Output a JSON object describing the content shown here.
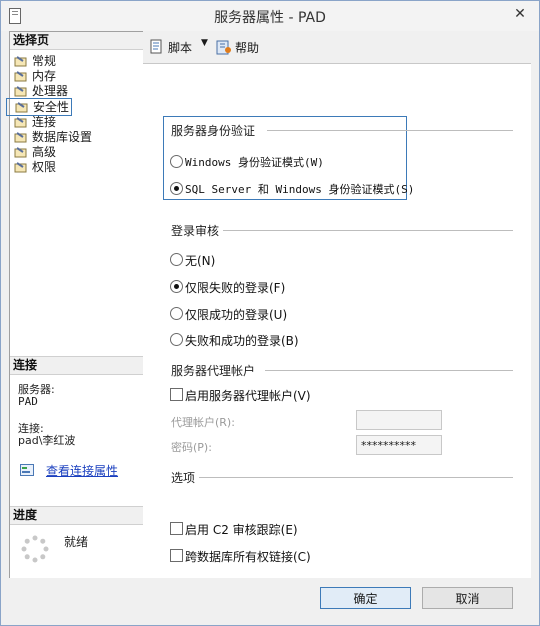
{
  "window": {
    "title": "服务器属性 - PAD",
    "close_glyph": "✕"
  },
  "left_pane": {
    "select_page_header": "选择页",
    "items": [
      {
        "label": "常规",
        "icon": "wrench-page-icon"
      },
      {
        "label": "内存",
        "icon": "wrench-page-icon"
      },
      {
        "label": "处理器",
        "icon": "wrench-page-icon"
      },
      {
        "label": "安全性",
        "icon": "wrench-page-icon",
        "selected": true
      },
      {
        "label": "连接",
        "icon": "wrench-page-icon"
      },
      {
        "label": "数据库设置",
        "icon": "wrench-page-icon"
      },
      {
        "label": "高级",
        "icon": "wrench-page-icon"
      },
      {
        "label": "权限",
        "icon": "wrench-page-icon"
      }
    ],
    "connection_header": "连接",
    "server_label": "服务器:",
    "server_value": "PAD",
    "connection_label": "连接:",
    "connection_value": "pad\\李红波",
    "view_connection_link": "查看连接属性",
    "progress_header": "进度",
    "progress_status": "就绪"
  },
  "toolbar": {
    "script_label": "脚本",
    "help_label": "帮助"
  },
  "auth": {
    "title": "服务器身份验证",
    "options": [
      {
        "label": "Windows 身份验证模式(W)",
        "checked": false
      },
      {
        "label": "SQL Server 和 Windows 身份验证模式(S)",
        "checked": true
      }
    ]
  },
  "audit": {
    "title": "登录审核",
    "options": [
      {
        "label": "无(N)",
        "checked": false
      },
      {
        "label": "仅限失败的登录(F)",
        "checked": true
      },
      {
        "label": "仅限成功的登录(U)",
        "checked": false
      },
      {
        "label": "失败和成功的登录(B)",
        "checked": false
      }
    ]
  },
  "proxy": {
    "title": "服务器代理帐户",
    "enable_label": "启用服务器代理帐户(V)",
    "account_label": "代理帐户(R):",
    "account_value": "",
    "password_label": "密码(P):",
    "password_value": "**********"
  },
  "options": {
    "title": "选项",
    "c2_label": "启用 C2 审核跟踪(E)",
    "cross_db_label": "跨数据库所有权链接(C)"
  },
  "footer": {
    "ok_label": "确定",
    "cancel_label": "取消"
  }
}
